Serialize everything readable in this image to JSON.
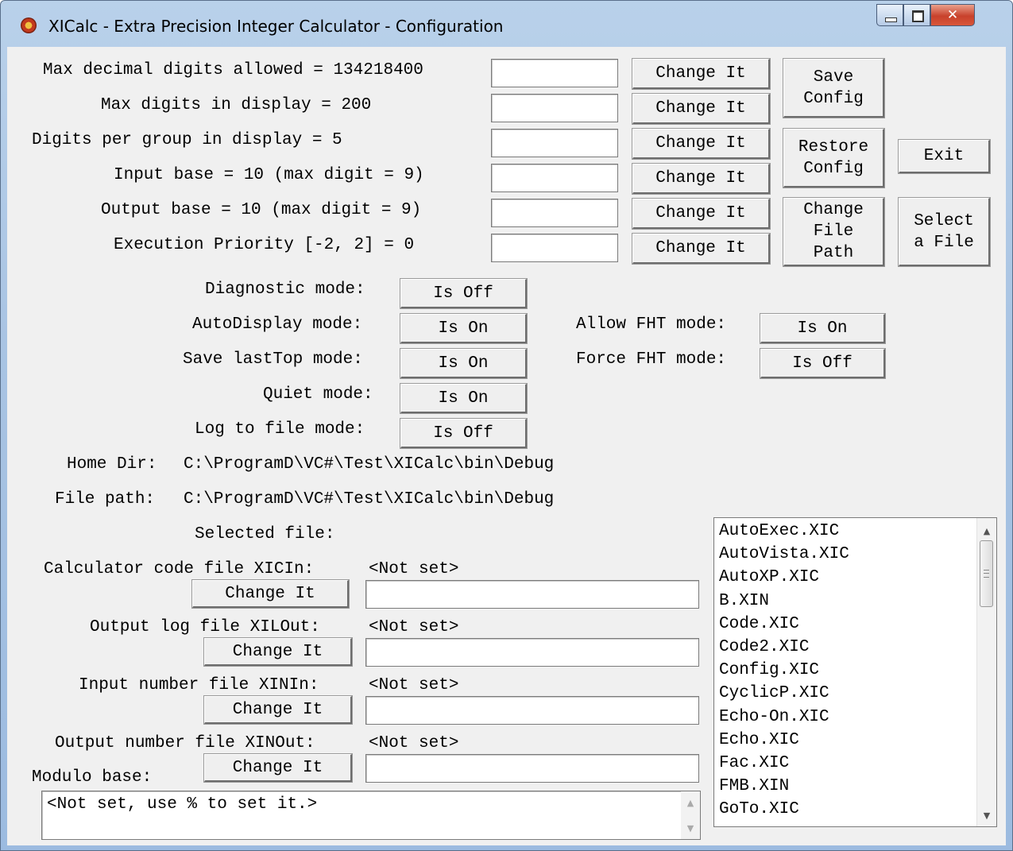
{
  "window": {
    "title": "XICalc - Extra Precision Integer Calculator - Configuration"
  },
  "settings": [
    {
      "label": "Max decimal digits allowed = 134218400",
      "button": "Change It",
      "value": ""
    },
    {
      "label": "Max digits in display = 200",
      "button": "Change It",
      "value": ""
    },
    {
      "label": "Digits per group in display = 5",
      "button": "Change It",
      "value": ""
    },
    {
      "label": "Input base = 10 (max digit = 9)",
      "button": "Change It",
      "value": ""
    },
    {
      "label": "Output base = 10 (max digit = 9)",
      "button": "Change It",
      "value": ""
    },
    {
      "label": "Execution Priority [-2, 2] = 0",
      "button": "Change It",
      "value": ""
    }
  ],
  "actions": {
    "save_config": "Save\nConfig",
    "restore_config": "Restore\nConfig",
    "exit": "Exit",
    "change_file_path": "Change\nFile\nPath",
    "select_file": "Select\na File"
  },
  "modes": [
    {
      "label": "Diagnostic mode:",
      "state": "Is Off"
    },
    {
      "label": "AutoDisplay mode:",
      "state": "Is On"
    },
    {
      "label": "Save lastTop mode:",
      "state": "Is On"
    },
    {
      "label": "Quiet mode:",
      "state": "Is On"
    },
    {
      "label": "Log to file mode:",
      "state": "Is Off"
    }
  ],
  "fht_modes": [
    {
      "label": "Allow FHT mode:",
      "state": "Is On"
    },
    {
      "label": "Force FHT mode:",
      "state": "Is Off"
    }
  ],
  "paths": {
    "home_dir_label": "Home Dir:",
    "home_dir": "C:\\ProgramD\\VC#\\Test\\XICalc\\bin\\Debug",
    "file_path_label": "File path:",
    "file_path": "C:\\ProgramD\\VC#\\Test\\XICalc\\bin\\Debug",
    "selected_file_label": "Selected file:",
    "selected_file": ""
  },
  "files": [
    {
      "label": "Calculator code file XICIn:",
      "status": "<Not set>",
      "button": "Change It",
      "value": ""
    },
    {
      "label": "Output log file XILOut:",
      "status": "<Not set>",
      "button": "Change It",
      "value": ""
    },
    {
      "label": "Input number file XINIn:",
      "status": "<Not set>",
      "button": "Change It",
      "value": ""
    },
    {
      "label": "Output number file XINOut:",
      "status": "<Not set>",
      "button": "Change It",
      "value": ""
    }
  ],
  "modulo": {
    "label": "Modulo base:",
    "button": "Change It",
    "value": "",
    "text": "<Not set, use % to set it.>"
  },
  "file_list": {
    "items": [
      "AutoExec.XIC",
      "AutoVista.XIC",
      "AutoXP.XIC",
      "B.XIN",
      "Code.XIC",
      "Code2.XIC",
      "Config.XIC",
      "CyclicP.XIC",
      "Echo-On.XIC",
      "Echo.XIC",
      "Fac.XIC",
      "FMB.XIN",
      "GoTo.XIC"
    ],
    "scroll_position": 0.1
  },
  "colors": {
    "frame": "#a9c4e3",
    "client": "#f0f0f0",
    "close_button": "#c8412b"
  }
}
